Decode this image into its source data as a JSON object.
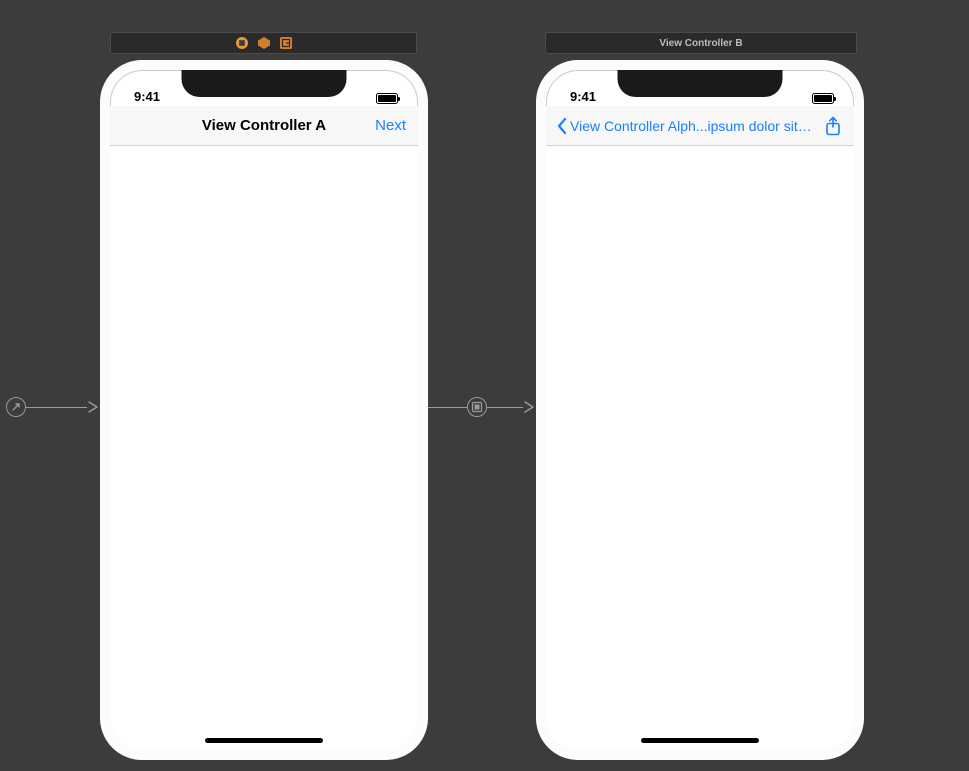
{
  "scenes": {
    "a": {
      "header_label": ""
    },
    "b": {
      "header_label": "View Controller B"
    }
  },
  "phones": {
    "a": {
      "status_time": "9:41",
      "nav_title": "View Controller A",
      "nav_right_button": "Next"
    },
    "b": {
      "status_time": "9:41",
      "back_label": "View Controller Alph...ipsum dolor sit amet"
    }
  },
  "colors": {
    "ios_link": "#1b7fff",
    "canvas_bg": "#3c3c3c",
    "nav_bg": "#f7f7f7"
  }
}
